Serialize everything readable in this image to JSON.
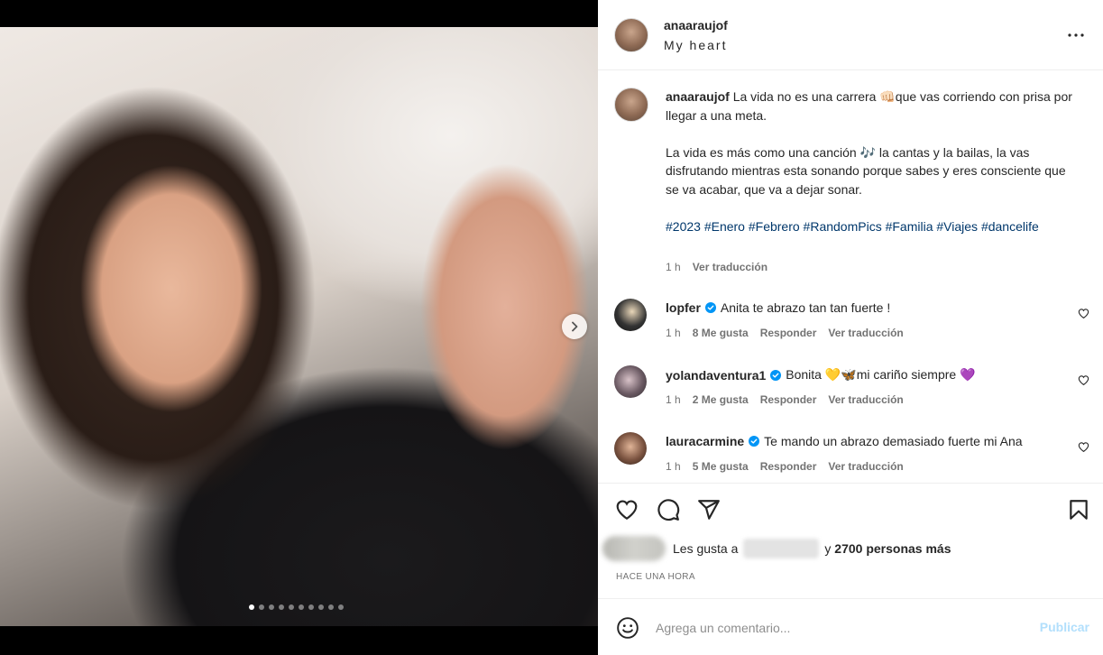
{
  "post": {
    "owner": "anaaraujof",
    "location": "My heart",
    "caption": {
      "username": "anaaraujof",
      "line1": "La vida no es una carrera 👊🏻que vas corriendo con prisa por llegar a una meta.",
      "line2": "La vida es más como una canción 🎶 la cantas y la bailas, la vas disfrutando mientras esta sonando porque sabes y eres consciente que se va acabar, que va a dejar sonar.",
      "hashtags": "#2023 #Enero #Febrero #RandomPics #Familia #Viajes #dancelife",
      "time": "1 h",
      "translate": "Ver traducción"
    }
  },
  "comments": [
    {
      "username": "lopfer",
      "text": "Anita te abrazo tan tan fuerte !",
      "time": "1 h",
      "likes": "8 Me gusta",
      "reply": "Responder",
      "translate": "Ver traducción"
    },
    {
      "username": "yolandaventura1",
      "text": "Bonita 💛🦋mi cariño siempre 💜",
      "time": "1 h",
      "likes": "2 Me gusta",
      "reply": "Responder",
      "translate": "Ver traducción"
    },
    {
      "username": "lauracarmine",
      "text": "Te mando un abrazo demasiado fuerte mi Ana",
      "time": "1 h",
      "likes": "5 Me gusta",
      "reply": "Responder",
      "translate": "Ver traducción"
    }
  ],
  "likes": {
    "prefix": "Les gusta a",
    "middle": "y",
    "count": "2700 personas más"
  },
  "timestamp": "HACE UNA HORA",
  "add_comment": {
    "placeholder": "Agrega un comentario...",
    "publish": "Publicar"
  },
  "carousel": {
    "total": 10,
    "current": 1
  },
  "colors": {
    "hashtag": "#00376b",
    "verified": "#0095f6",
    "publish_disabled": "#b2dffc"
  }
}
